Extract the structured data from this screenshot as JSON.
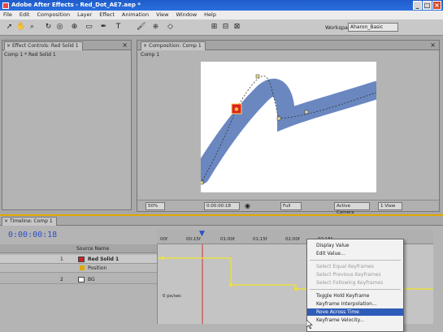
{
  "window": {
    "title": "Adobe After Effects - Red_Dot_AE7.aep *",
    "min_label": "_",
    "max_label": "□",
    "close_label": "×"
  },
  "menu": [
    "File",
    "Edit",
    "Composition",
    "Layer",
    "Effect",
    "Animation",
    "View",
    "Window",
    "Help"
  ],
  "toolbar": {
    "workspace_label": "Workspace:",
    "workspace_value": "Aharon_Basic"
  },
  "effect_panel": {
    "tab_label": "Effect Controls: Red Solid 1",
    "subtitle": "Comp 1 * Red Solid 1"
  },
  "comp_panel": {
    "tab_label": "Composition: Comp 1",
    "subtitle": "Comp 1",
    "zoom": "50%",
    "timecode": "0:00:00:18",
    "resolution": "Full",
    "camera": "Active Camera",
    "views": "1 View"
  },
  "timeline": {
    "tab_label": "Timeline: Comp 1",
    "current_time": "0:00:00:18",
    "column_source": "Source Name",
    "layers": [
      {
        "num": "1",
        "name": "Red Solid 1",
        "color": "#cc2222"
      },
      {
        "num": "",
        "name": "Position",
        "color": ""
      },
      {
        "num": "2",
        "name": "BG",
        "color": "#ffffff"
      }
    ],
    "ruler_labels": [
      "00f",
      "00:15f",
      "01:00f",
      "01:15f",
      "02:00f",
      "02:15f"
    ],
    "graph_label": "0 px/sec"
  },
  "context_menu": {
    "items": [
      {
        "label": "Display Value",
        "disabled": false
      },
      {
        "label": "Edit Value...",
        "disabled": false
      },
      {
        "label": "Select Equal Keyframes",
        "disabled": true
      },
      {
        "label": "Select Previous Keyframes",
        "disabled": true
      },
      {
        "label": "Select Following Keyframes",
        "disabled": true
      },
      {
        "label": "Toggle Hold Keyframe",
        "disabled": false
      },
      {
        "label": "Keyframe Interpolation...",
        "disabled": false
      },
      {
        "label": "Rove Across Time",
        "disabled": false,
        "highlighted": true
      },
      {
        "label": "Keyframe Velocity...",
        "disabled": false
      }
    ]
  },
  "colors": {
    "accent": "#e0a800",
    "path": "#6a87c0",
    "solid": "#dd2222",
    "keyframe": "#d8c040"
  }
}
